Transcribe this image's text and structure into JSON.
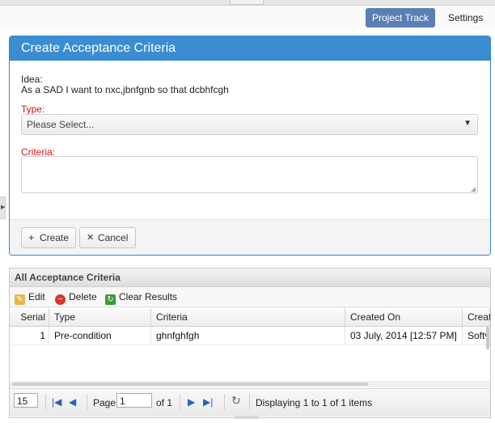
{
  "nav": {
    "project_track": "Project Track",
    "settings": "Settings"
  },
  "dialog": {
    "title": "Create Acceptance Criteria",
    "idea_label": "Idea:",
    "idea_text": "As a SAD I want to nxc,jbnfgnb so that dcbhfcgh",
    "type_label": "Type:",
    "type_value": "Please Select...",
    "criteria_label": "Criteria:",
    "criteria_value": "",
    "create_label": "Create",
    "cancel_label": "Cancel"
  },
  "grid": {
    "title": "All Acceptance Criteria",
    "toolbar": {
      "edit": "Edit",
      "delete": "Delete",
      "clear": "Clear Results"
    },
    "columns": [
      "Serial",
      "Type",
      "Criteria",
      "Created On",
      "Creat"
    ],
    "rows": [
      {
        "serial": "1",
        "type": "Pre-condition",
        "criteria": "ghnfghfgh",
        "created_on": "03 July, 2014 [12:57 PM]",
        "created_by": "Softv"
      }
    ]
  },
  "pager": {
    "page_size": "15",
    "page_label": "Page",
    "page_value": "1",
    "of_label": "of 1",
    "display_text": "Displaying 1 to 1 of 1 items"
  },
  "colors": {
    "accent": "#3b8dd1",
    "nav_active": "#5b7fb4",
    "required": "#d21414"
  },
  "icons": [
    "plus-icon",
    "close-icon",
    "edit-icon",
    "delete-icon",
    "refresh-icon",
    "first-page-icon",
    "prev-page-icon",
    "next-page-icon",
    "last-page-icon",
    "reload-icon",
    "dropdown-arrow-icon"
  ]
}
